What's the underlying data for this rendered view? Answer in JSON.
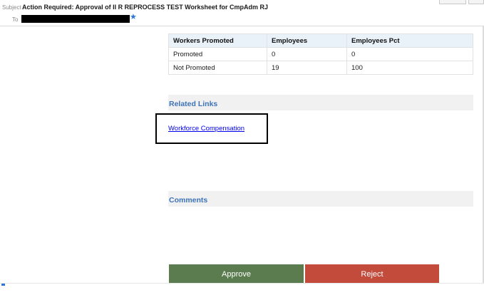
{
  "header": {
    "subject_label": "Subject",
    "subject": "Action Required: Approval of II R REPROCESS TEST Worksheet for CmpAdm RJ",
    "to_label": "To"
  },
  "table": {
    "headers": [
      "Workers Promoted",
      "Employees",
      "Employees Pct"
    ],
    "rows": [
      [
        "Promoted",
        "0",
        "0"
      ],
      [
        "Not Promoted",
        "19",
        "100"
      ]
    ]
  },
  "related_links": {
    "title": "Related Links",
    "link_label": "Workforce Compensation"
  },
  "comments": {
    "title": "Comments"
  },
  "actions": {
    "approve_label": "Approve",
    "approve_color": "#5a7c4e",
    "reject_label": "Reject",
    "reject_color": "#c24b3c"
  },
  "icons": {
    "recipient_flag": "star-icon"
  }
}
